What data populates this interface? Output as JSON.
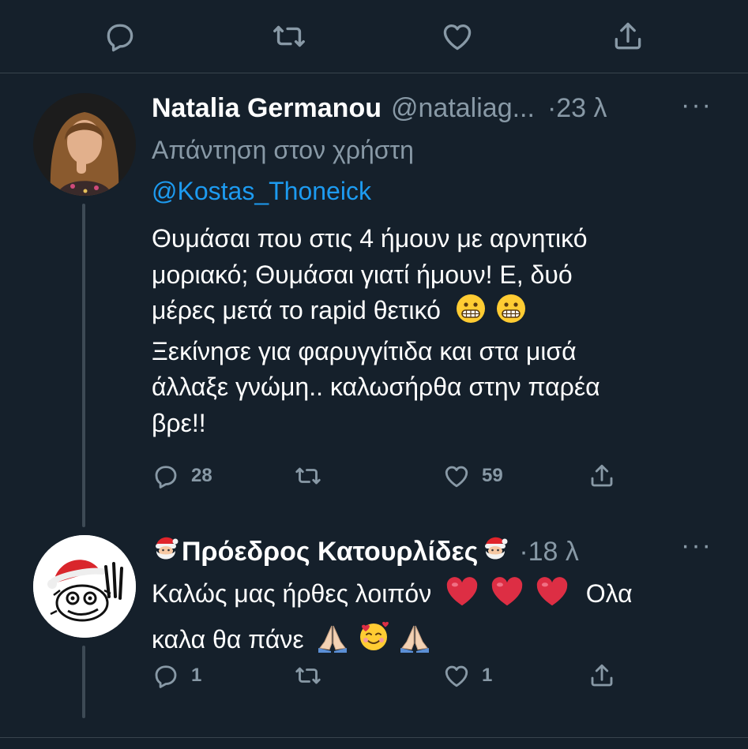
{
  "top_actions": [
    "reply-icon",
    "retweet-icon",
    "like-icon",
    "share-icon"
  ],
  "tweet1": {
    "display_name": "Natalia Germanou",
    "handle": "@nataliag...",
    "time": "·23 λ",
    "more": "···",
    "reply_prefix": "Απάντηση στον χρήστη",
    "reply_handle": "@Kostas_Thoneick",
    "line1": "Θυμάσαι που στις 4 ήμουν με αρνητικό",
    "line2": "μοριακό; Θυμάσαι γιατί ήμουν! Ε, δυό",
    "line3": "μέρες μετά το rapid θετικό",
    "line4": "Ξεκίνησε για φαρυγγίτιδα και στα μισά",
    "line5": "άλλαξε γνώμη.. καλωσήρθα στην παρέα",
    "line6": "βρε!!",
    "replies": "28",
    "retweets": "",
    "likes": "59"
  },
  "tweet2": {
    "display_name": "Πρόεδρος Κατουρλίδες",
    "time": "·18 λ",
    "more": "···",
    "line1": "Καλώς μας ήρθες λοιπόν",
    "line1b": "Ολα",
    "line2": "καλα θα πάνε",
    "replies": "1",
    "retweets": "",
    "likes": "1"
  },
  "colors": {
    "background": "#15202b",
    "muted": "#8899a6",
    "link": "#1d9bf0",
    "divider": "#38444d"
  }
}
